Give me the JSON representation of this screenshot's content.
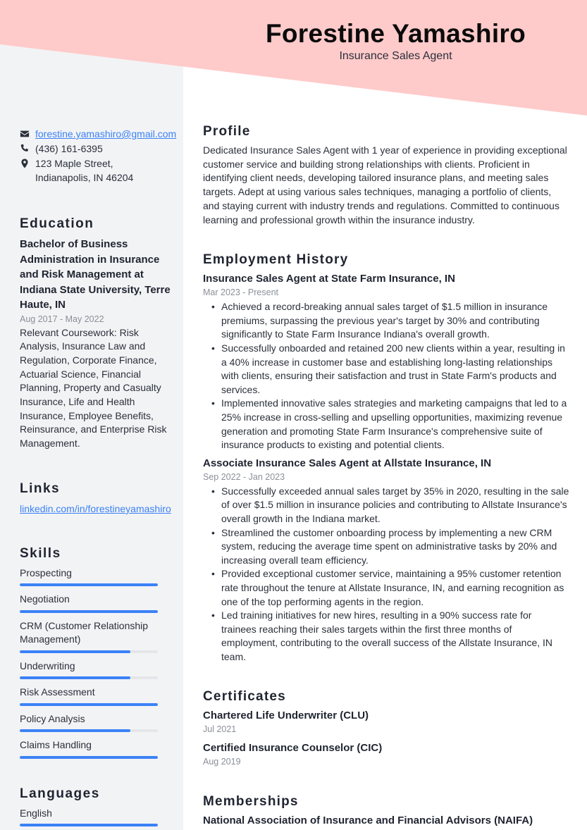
{
  "colors": {
    "banner": "#ffcaca",
    "sidebar_bg": "#f2f3f5",
    "accent": "#3b82f6"
  },
  "header": {
    "name": "Forestine Yamashiro",
    "title": "Insurance Sales Agent"
  },
  "contact": {
    "email": {
      "icon": "envelope-icon",
      "text": "forestine.yamashiro@gmail.com"
    },
    "phone": {
      "icon": "phone-icon",
      "text": "(436) 161-6395"
    },
    "address": {
      "icon": "map-pin-icon",
      "line1": "123 Maple Street,",
      "line2": "Indianapolis, IN 46204"
    }
  },
  "education": {
    "heading": "Education",
    "degree": "Bachelor of Business Administration in Insurance and Risk Management at Indiana State University, Terre Haute, IN",
    "dates": "Aug 2017 - May 2022",
    "description": "Relevant Coursework: Risk Analysis, Insurance Law and Regulation, Corporate Finance, Actuarial Science, Financial Planning, Property and Casualty Insurance, Life and Health Insurance, Employee Benefits, Reinsurance, and Enterprise Risk Management."
  },
  "links": {
    "heading": "Links",
    "items": [
      "linkedin.com/in/forestineyamashiro"
    ]
  },
  "skills": {
    "heading": "Skills",
    "items": [
      {
        "name": "Prospecting",
        "level": 1.0
      },
      {
        "name": "Negotiation",
        "level": 1.0
      },
      {
        "name": "CRM (Customer Relationship Management)",
        "level": 0.8
      },
      {
        "name": "Underwriting",
        "level": 0.8
      },
      {
        "name": "Risk Assessment",
        "level": 1.0
      },
      {
        "name": "Policy Analysis",
        "level": 0.8
      },
      {
        "name": "Claims Handling",
        "level": 1.0
      }
    ]
  },
  "languages": {
    "heading": "Languages",
    "items": [
      {
        "name": "English",
        "level": 1.0
      }
    ]
  },
  "profile": {
    "heading": "Profile",
    "text": "Dedicated Insurance Sales Agent with 1 year of experience in providing exceptional customer service and building strong relationships with clients. Proficient in identifying client needs, developing tailored insurance plans, and meeting sales targets. Adept at using various sales techniques, managing a portfolio of clients, and staying current with industry trends and regulations. Committed to continuous learning and professional growth within the insurance industry."
  },
  "employment": {
    "heading": "Employment History",
    "jobs": [
      {
        "title": "Insurance Sales Agent at State Farm Insurance, IN",
        "dates": "Mar 2023 - Present",
        "bullets": [
          "Achieved a record-breaking annual sales target of $1.5 million in insurance premiums, surpassing the previous year's target by 30% and contributing significantly to State Farm Insurance Indiana's overall growth.",
          "Successfully onboarded and retained 200 new clients within a year, resulting in a 40% increase in customer base and establishing long-lasting relationships with clients, ensuring their satisfaction and trust in State Farm's products and services.",
          "Implemented innovative sales strategies and marketing campaigns that led to a 25% increase in cross-selling and upselling opportunities, maximizing revenue generation and promoting State Farm Insurance's comprehensive suite of insurance products to existing and potential clients."
        ]
      },
      {
        "title": "Associate Insurance Sales Agent at Allstate Insurance, IN",
        "dates": "Sep 2022 - Jan 2023",
        "bullets": [
          "Successfully exceeded annual sales target by 35% in 2020, resulting in the sale of over $1.5 million in insurance policies and contributing to Allstate Insurance's overall growth in the Indiana market.",
          "Streamlined the customer onboarding process by implementing a new CRM system, reducing the average time spent on administrative tasks by 20% and increasing overall team efficiency.",
          "Provided exceptional customer service, maintaining a 95% customer retention rate throughout the tenure at Allstate Insurance, IN, and earning recognition as one of the top performing agents in the region.",
          "Led training initiatives for new hires, resulting in a 90% success rate for trainees reaching their sales targets within the first three months of employment, contributing to the overall success of the Allstate Insurance, IN team."
        ]
      }
    ]
  },
  "certificates": {
    "heading": "Certificates",
    "items": [
      {
        "name": "Chartered Life Underwriter (CLU)",
        "date": "Jul 2021"
      },
      {
        "name": "Certified Insurance Counselor (CIC)",
        "date": "Aug 2019"
      }
    ]
  },
  "memberships": {
    "heading": "Memberships",
    "items": [
      "National Association of Insurance and Financial Advisors (NAIFA)"
    ]
  }
}
